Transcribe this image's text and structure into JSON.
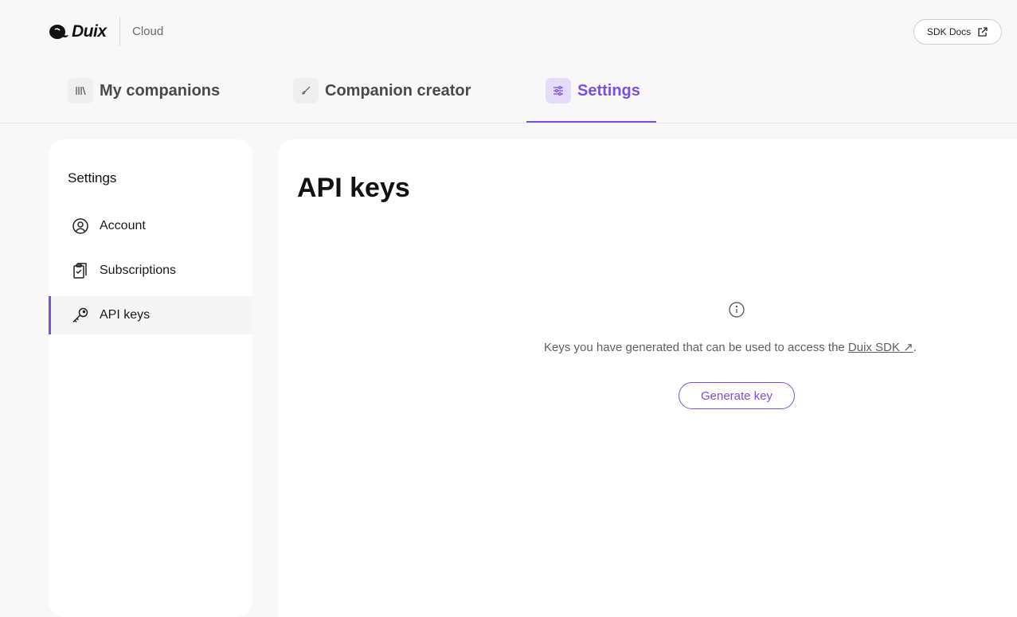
{
  "header": {
    "logo_text": "Duix",
    "logo_sub": "Cloud",
    "sdk_docs_label": "SDK Docs"
  },
  "tabs": [
    {
      "label": "My companions",
      "icon": "library-icon",
      "active": false
    },
    {
      "label": "Companion creator",
      "icon": "brush-icon",
      "active": false
    },
    {
      "label": "Settings",
      "icon": "sliders-icon",
      "active": true
    }
  ],
  "sidebar": {
    "title": "Settings",
    "items": [
      {
        "label": "Account",
        "icon": "user-circle-icon",
        "active": false
      },
      {
        "label": "Subscriptions",
        "icon": "clipboard-icon",
        "active": false
      },
      {
        "label": "API keys",
        "icon": "key-icon",
        "active": true
      }
    ]
  },
  "main": {
    "title": "API keys",
    "empty_text_prefix": "Keys you have generated that can be used to access the ",
    "empty_link": "Duix SDK ↗",
    "empty_text_suffix": ".",
    "generate_label": "Generate key"
  },
  "colors": {
    "accent": "#7b4fe0",
    "accent_bg": "#e5dcfb",
    "page_bg": "#f8f8f8"
  }
}
